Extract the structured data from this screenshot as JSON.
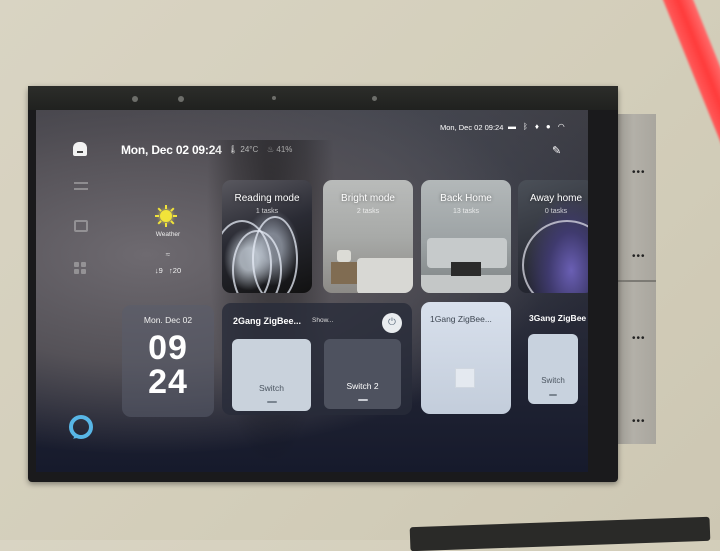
{
  "header": {
    "home_icon": "home-icon",
    "datetime": "Mon, Dec 02 09:24",
    "temperature": "24°C",
    "temperature_icon": "thermometer-icon",
    "humidity": "41%",
    "humidity_icon": "droplet-icon"
  },
  "status_bar": {
    "time": "Mon, Dec 02 09:24",
    "icons": [
      "car-icon",
      "bluetooth-icon",
      "microphone-icon",
      "lightbulb-icon",
      "wifi-icon"
    ],
    "edit_icon": "pencil-icon"
  },
  "sidebar": {
    "items": [
      {
        "icon": "list-icon"
      },
      {
        "icon": "square-icon"
      },
      {
        "icon": "grid-icon"
      }
    ],
    "assistant_icon": "alexa-icon"
  },
  "weather": {
    "icon": "sun-icon",
    "label": "Weather",
    "wind_icon": "wind-icon",
    "low": "9",
    "high": "20",
    "low_icon": "↓",
    "high_icon": "↑"
  },
  "scenes": [
    {
      "title": "Reading mode",
      "subtitle": "1 tasks"
    },
    {
      "title": "Bright mode",
      "subtitle": "2 tasks"
    },
    {
      "title": "Back Home",
      "subtitle": "13 tasks"
    },
    {
      "title": "Away home",
      "subtitle": "0 tasks"
    }
  ],
  "clock": {
    "date": "Mon. Dec 02",
    "hours": "09",
    "minutes": "24"
  },
  "devices": {
    "gang2": {
      "title": "2Gang ZigBee...",
      "subtitle": "Show...",
      "power_icon": "⏻",
      "switches": [
        {
          "label": "Switch",
          "state": "on"
        },
        {
          "label": "Switch 2",
          "state": "off"
        }
      ]
    },
    "gang1": {
      "title": "1Gang ZigBee...",
      "state": "on"
    },
    "gang3": {
      "title": "3Gang ZigBee",
      "switches": [
        {
          "label": "Switch",
          "state": "on"
        }
      ]
    }
  },
  "side_module": {
    "dots": "•••"
  }
}
